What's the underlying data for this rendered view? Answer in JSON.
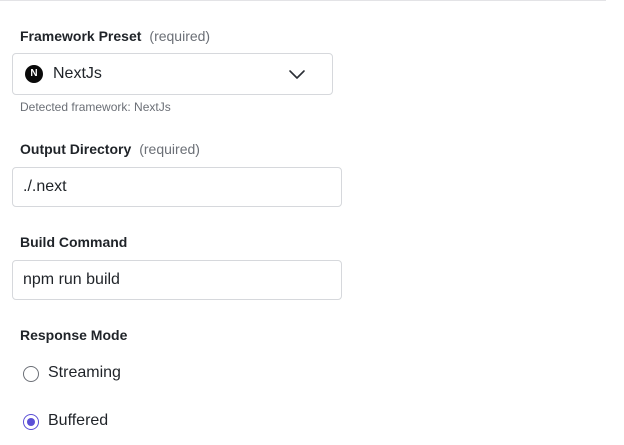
{
  "framework": {
    "label": "Framework Preset",
    "required": "(required)",
    "selected": "NextJs",
    "logo_letter": "N",
    "logo_icon": "nextjs-logo-icon",
    "hint": "Detected framework: NextJs"
  },
  "output_directory": {
    "label": "Output Directory",
    "required": "(required)",
    "value": "./.next"
  },
  "build_command": {
    "label": "Build Command",
    "value": "npm run build"
  },
  "response_mode": {
    "label": "Response Mode",
    "options": [
      {
        "label": "Streaming",
        "checked": false
      },
      {
        "label": "Buffered",
        "checked": true
      }
    ]
  },
  "colors": {
    "accent": "#5b4fd6",
    "border": "#d6d8dc",
    "muted_text": "#6b6f76"
  }
}
